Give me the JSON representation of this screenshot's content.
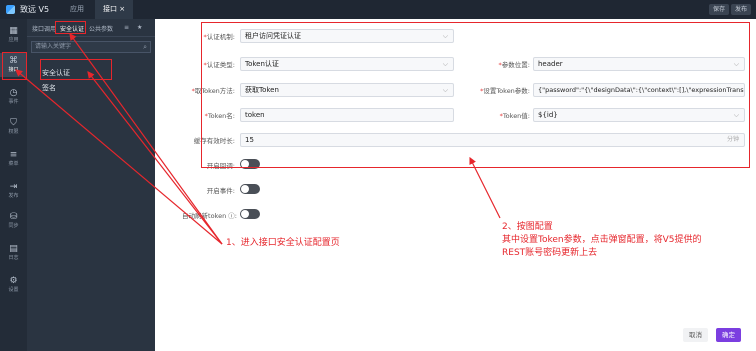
{
  "topbar": {
    "app_title": "致远 V5",
    "tabs": [
      "应用",
      "接口"
    ],
    "close_glyph": "×",
    "buttons": [
      "保存",
      "发布"
    ]
  },
  "iconbar": [
    {
      "icon": "grid-icon",
      "glyph": "▦",
      "label": "应用"
    },
    {
      "icon": "interface-icon",
      "glyph": "⌘",
      "label": "接口"
    },
    {
      "icon": "event-icon",
      "glyph": "◷",
      "label": "事件"
    },
    {
      "icon": "permission-icon",
      "glyph": "⛉",
      "label": "权限"
    },
    {
      "icon": "list-icon",
      "glyph": "≡",
      "label": "菜单"
    },
    {
      "icon": "publish-icon",
      "glyph": "⇥",
      "label": "发布"
    },
    {
      "icon": "sync-icon",
      "glyph": "⛁",
      "label": "同步"
    },
    {
      "icon": "log-icon",
      "glyph": "▤",
      "label": "日志"
    },
    {
      "icon": "settings-icon",
      "glyph": "⚙",
      "label": "设置"
    }
  ],
  "panel": {
    "tabs": [
      "接口调用",
      "安全认证",
      "公共参数"
    ],
    "tool_glyphs": [
      "≡",
      "★"
    ],
    "search_placeholder": "请输入关键字",
    "search_glyph": "⌕",
    "items": [
      "安全认证",
      "签名"
    ]
  },
  "form": {
    "auth_mechanism": {
      "label": "认证机制:",
      "value": "租户访问凭证认证"
    },
    "auth_type": {
      "label": "认证类型:",
      "value": "Token认证"
    },
    "param_position": {
      "label": "参数位置:",
      "value": "header"
    },
    "get_token_method": {
      "label": "取Token方法:",
      "value": "获取Token"
    },
    "set_token_params": {
      "label": "设置Token参数:",
      "value": "{\"password\":\"{\\\"designData\\\":{\\\"context\\\":[],\\\"expressionTransl"
    },
    "token_name": {
      "label": "Token名:",
      "value": "token"
    },
    "token_value": {
      "label": "Token值:",
      "value": "${id}"
    },
    "cache_duration": {
      "label": "缓存有效时长:",
      "value": "15",
      "unit": "分钟"
    },
    "enable_fallback": {
      "label": "开启回调:"
    },
    "enable_event": {
      "label": "开启事件:"
    },
    "auto_refresh_token": {
      "label": "自动刷新token",
      "help_glyph": "ⓘ"
    },
    "required_mark": "*",
    "chevron_glyph": "⌵"
  },
  "annotations": {
    "step1": "1、进入接口安全认证配置页",
    "step2_title": "2、按图配置",
    "step2_line1": "其中设置Token参数，点击弹窗配置，将V5提供的",
    "step2_line2": "REST账号密码更新上去"
  },
  "footer": {
    "cancel": "取消",
    "ok": "确定"
  },
  "colors": {
    "highlight": "#e6262c",
    "primary": "#7b3ee0",
    "sidebar": "#2a3441"
  }
}
